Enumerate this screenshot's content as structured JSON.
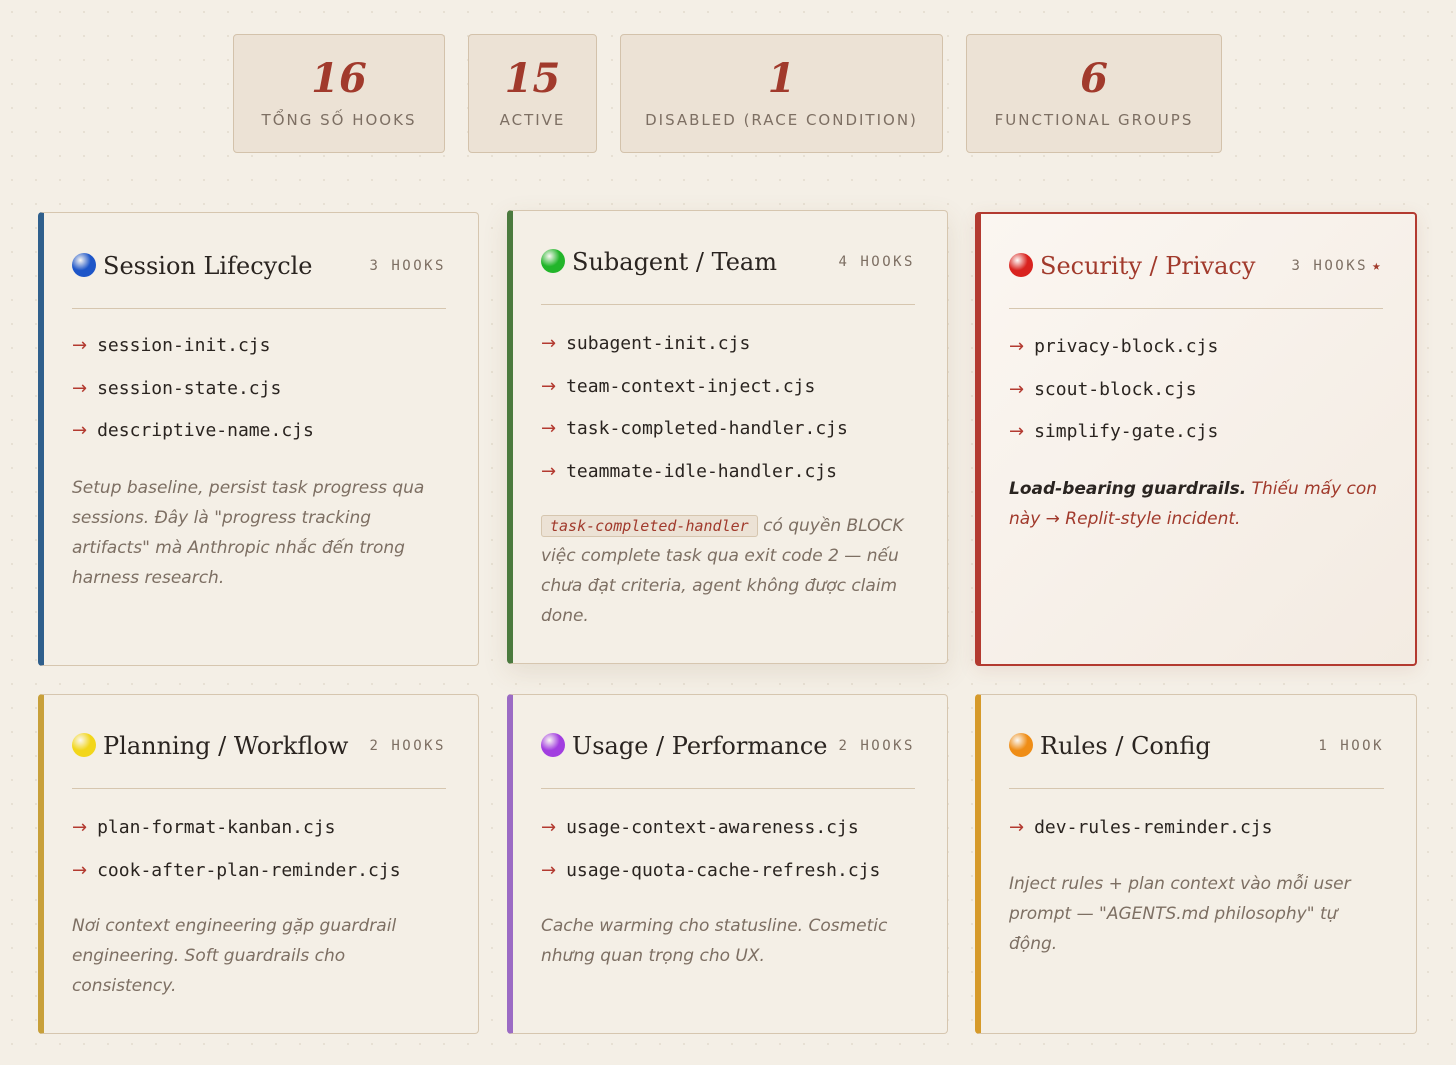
{
  "stats": [
    {
      "number": "16",
      "label": "Tổng số hooks"
    },
    {
      "number": "15",
      "label": "Active"
    },
    {
      "number": "1",
      "label": "Disabled (race condition)"
    },
    {
      "number": "6",
      "label": "Functional groups"
    }
  ],
  "groups": {
    "session": {
      "title": "Session Lifecycle",
      "count": "3 hooks",
      "accent": "#2f5f8c",
      "dot": "#1d55c8",
      "files": [
        "session-init.cjs",
        "session-state.cjs",
        "descriptive-name.cjs"
      ],
      "note": "Setup baseline, persist task progress qua sessions. Đây là \"progress tracking artifacts\" mà Anthropic nhắc đến trong harness research."
    },
    "team": {
      "title": "Subagent / Team",
      "count": "4 hooks",
      "accent": "#4b7a3e",
      "dot": "#22b52a",
      "files": [
        "subagent-init.cjs",
        "team-context-inject.cjs",
        "task-completed-handler.cjs",
        "teammate-idle-handler.cjs"
      ],
      "note_code": "task-completed-handler",
      "note": " có quyền BLOCK việc complete task qua exit code 2 — nếu chưa đạt criteria, agent không được claim done."
    },
    "security": {
      "title": "Security / Privacy",
      "count": "3 hooks",
      "star": "★",
      "accent": "#b33a30",
      "dot": "#d9231f",
      "files": [
        "privacy-block.cjs",
        "scout-block.cjs",
        "simplify-gate.cjs"
      ],
      "note_strong": "Load-bearing guardrails.",
      "note": " Thiếu mấy con này → Replit-style incident."
    },
    "planning": {
      "title": "Planning / Workflow",
      "count": "2 hooks",
      "accent": "#c8a03a",
      "dot": "#f2d61a",
      "files": [
        "plan-format-kanban.cjs",
        "cook-after-plan-reminder.cjs"
      ],
      "note": "Nơi context engineering gặp guardrail engineering. Soft guardrails cho consistency."
    },
    "usage": {
      "title": "Usage / Performance",
      "count": "2 hooks",
      "accent": "#9b6bc4",
      "dot": "#a23ee0",
      "files": [
        "usage-context-awareness.cjs",
        "usage-quota-cache-refresh.cjs"
      ],
      "note": "Cache warming cho statusline. Cosmetic nhưng quan trọng cho UX."
    },
    "rules": {
      "title": "Rules / Config",
      "count": "1 hook",
      "accent": "#d69a2a",
      "dot": "#ef8d16",
      "files": [
        "dev-rules-reminder.cjs"
      ],
      "note": "Inject rules + plan context vào mỗi user prompt — \"AGENTS.md philosophy\" tự động."
    }
  }
}
